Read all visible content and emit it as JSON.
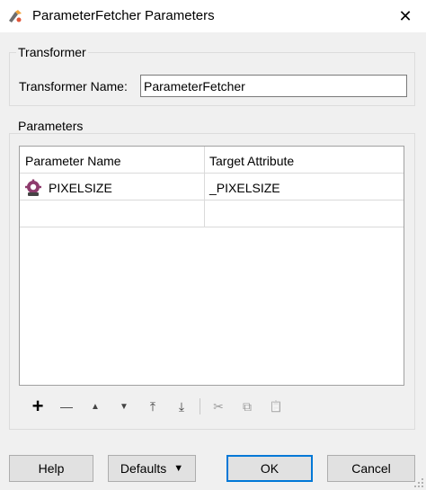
{
  "window": {
    "title": "ParameterFetcher Parameters",
    "close_glyph": "✕"
  },
  "transformer_group": {
    "title": "Transformer",
    "name_label": "Transformer Name:",
    "name_value": "ParameterFetcher"
  },
  "parameters_group": {
    "title": "Parameters",
    "columns": [
      "Parameter Name",
      "Target Attribute"
    ],
    "rows": [
      {
        "icon": "parameter-icon",
        "parameter_name": "PIXELSIZE",
        "target_attribute": "_PIXELSIZE"
      },
      {
        "parameter_name": "",
        "target_attribute": ""
      }
    ]
  },
  "toolbar": {
    "add": "+",
    "remove": "—",
    "move_up": "▲",
    "move_down": "▼",
    "move_top": "⤒",
    "move_bottom": "⤓",
    "cut": "✂",
    "copy": "⧉",
    "paste": "📋"
  },
  "buttons": {
    "help": "Help",
    "defaults": "Defaults",
    "defaults_arrow": "▼",
    "ok": "OK",
    "cancel": "Cancel"
  }
}
